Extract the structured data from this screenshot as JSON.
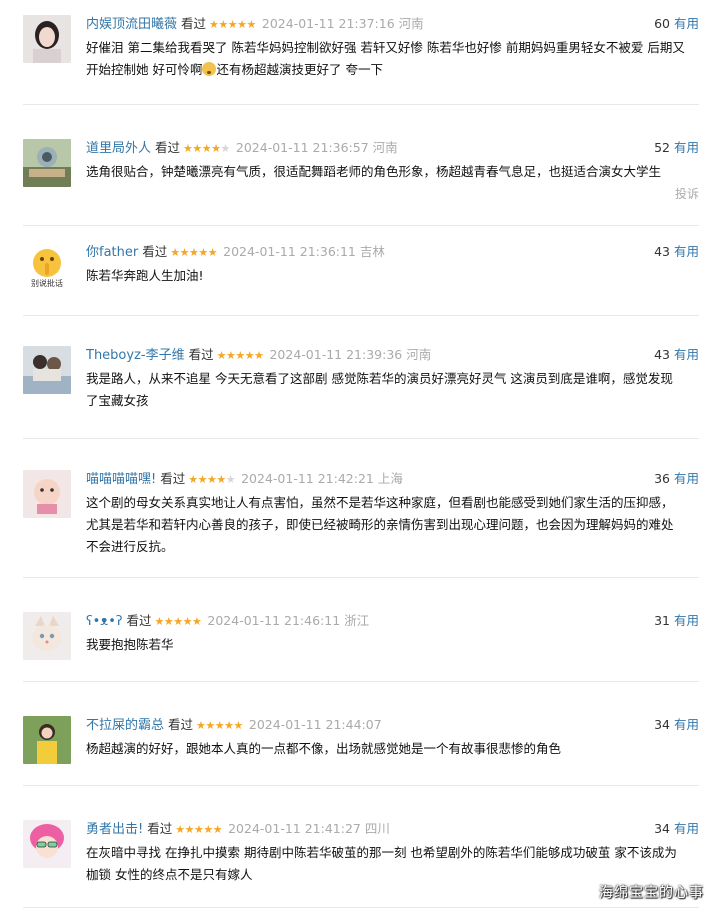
{
  "labels": {
    "watched": "看过",
    "useful": "有用",
    "report": "投诉"
  },
  "colors": {
    "username": "#3377aa",
    "star_on": "#f5a623",
    "star_off": "#d6d6d6",
    "meta_grey": "#aaaaaa"
  },
  "comments": [
    {
      "user": "内娱顶流田曦薇",
      "rating": 5,
      "time": "2024-01-11 21:37:16",
      "location": "河南",
      "votes": "60",
      "content": "好催泪 第二集给我看哭了 陈若华妈妈控制欲好强 若轩又好惨 陈若华也好惨 前期妈妈重男轻女不被爱 后期又开始控制她 好可怜啊",
      "content_tail": "还有杨超越演技更好了 夸一下",
      "avatar_icon": "girl-portrait-avatar"
    },
    {
      "user": "道里局外人",
      "rating": 4,
      "time": "2024-01-11 21:36:57",
      "location": "河南",
      "votes": "52",
      "content": "选角很贴合，钟楚曦漂亮有气质，很适配舞蹈老师的角色形象，杨超越青春气息足，也挺适合演女大学生",
      "avatar_icon": "building-photo-avatar",
      "show_report": true
    },
    {
      "user": "你father",
      "rating": 5,
      "time": "2024-01-11 21:36:11",
      "location": "吉林",
      "votes": "43",
      "content": "陈若华奔跑人生加油!",
      "avatar_icon": "shush-emoji-avatar",
      "avatar_caption": "别说批话"
    },
    {
      "user": "Theboyz-李子维",
      "rating": 5,
      "time": "2024-01-11 21:39:36",
      "location": "河南",
      "votes": "43",
      "content": "我是路人，从来不追星 今天无意看了这部剧 感觉陈若华的演员好漂亮好灵气 这演员到底是谁啊，感觉发现了宝藏女孩",
      "avatar_icon": "couple-photo-avatar"
    },
    {
      "user": "喵喵喵喵嘿!",
      "rating": 4,
      "time": "2024-01-11 21:42:21",
      "location": "上海",
      "votes": "36",
      "content": "这个剧的母女关系真实地让人有点害怕，虽然不是若华这种家庭，但看剧也能感受到她们家生活的压抑感，尤其是若华和若轩内心善良的孩子，即使已经被畸形的亲情伤害到出现心理问题，也会因为理解妈妈的难处不会进行反抗。",
      "avatar_icon": "baby-photo-avatar"
    },
    {
      "user": "ʕ•ᴥ•ʔ",
      "rating": 5,
      "time": "2024-01-11 21:46:11",
      "location": "浙江",
      "votes": "31",
      "content": "我要抱抱陈若华",
      "avatar_icon": "cat-photo-avatar"
    },
    {
      "user": "不拉屎的霸总",
      "rating": 5,
      "time": "2024-01-11 21:44:07",
      "location": "",
      "votes": "34",
      "content": "杨超越演的好好，跟她本人真的一点都不像，出场就感觉她是一个有故事很悲惨的角色",
      "avatar_icon": "girl-yellow-avatar"
    },
    {
      "user": "勇者出击!",
      "rating": 5,
      "time": "2024-01-11 21:41:27",
      "location": "四川",
      "votes": "34",
      "content": "在灰暗中寻找 在挣扎中摸索 期待剧中陈若华破茧的那一刻 也希望剧外的陈若华们能够成功破茧 家不该成为枷锁 女性的终点不是只有嫁人",
      "avatar_icon": "anime-pink-hair-avatar"
    }
  ],
  "watermark": "海绵宝宝的心事"
}
